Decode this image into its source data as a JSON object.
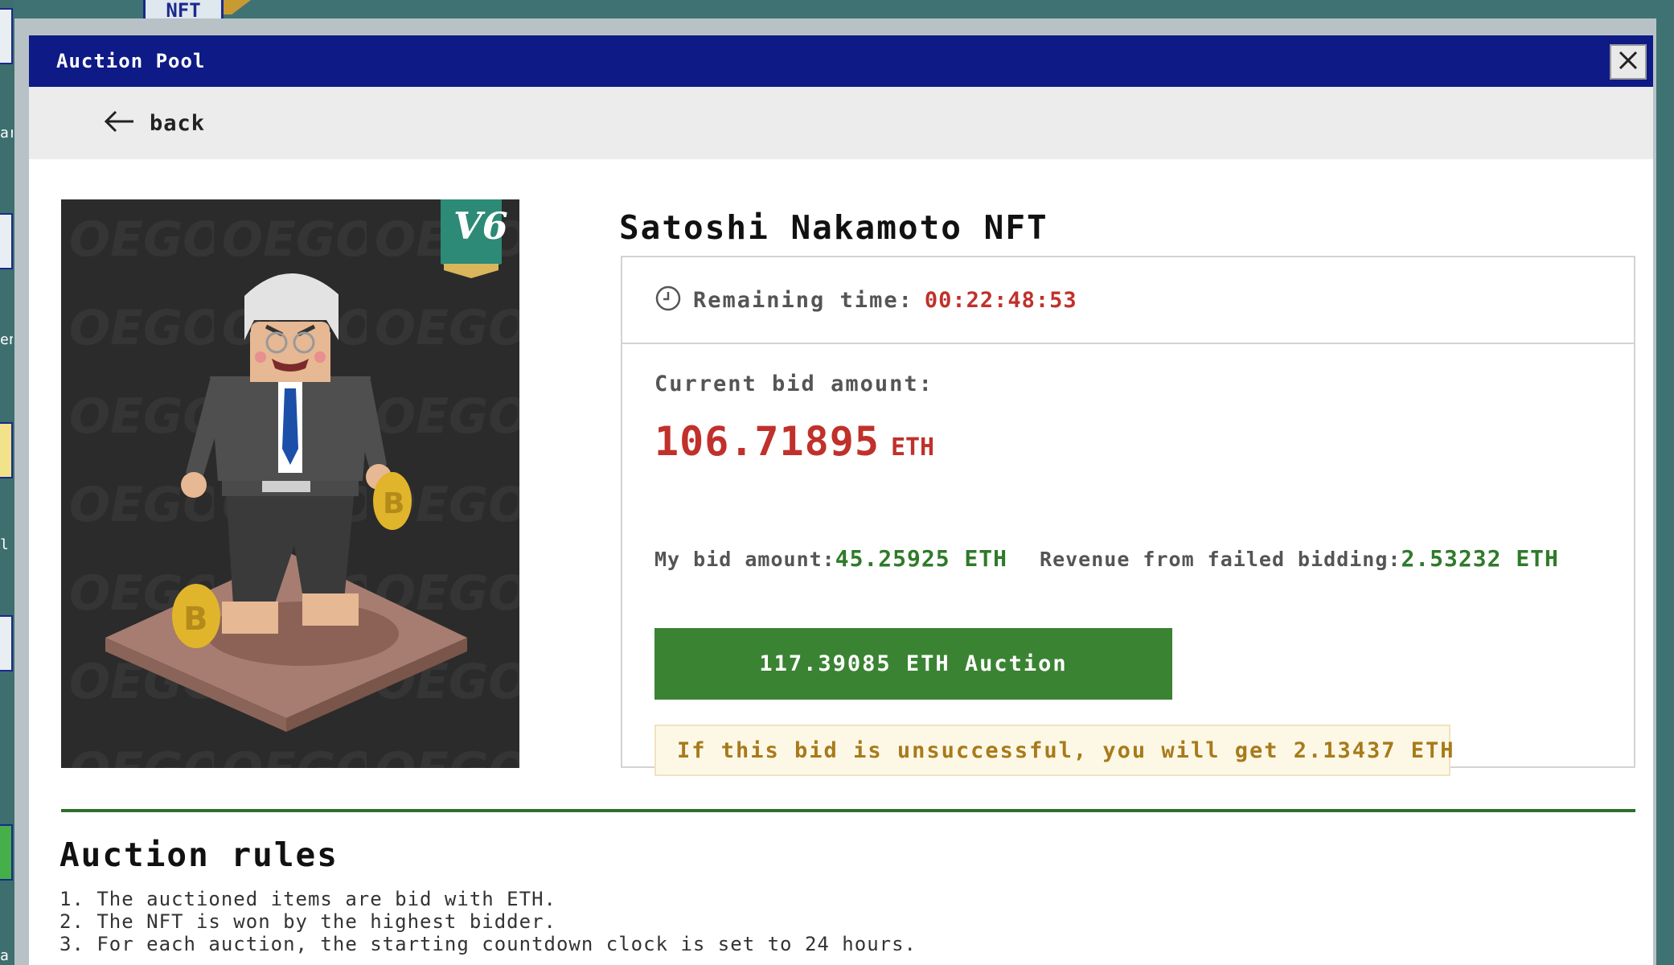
{
  "desktop": {
    "nft_icon_label": "NFT",
    "side_fragments": [
      "ar",
      "en",
      "l",
      "a"
    ]
  },
  "window": {
    "title": "Auction Pool",
    "close_icon": "close-icon"
  },
  "nav": {
    "back_label": "back",
    "back_icon": "arrow-left-icon"
  },
  "nft": {
    "title": "Satoshi Nakamoto NFT",
    "badge": "V6",
    "image_alt": "Lego-style minifigure with white hair holding bitcoin coins on a brown base"
  },
  "auction": {
    "remaining_label": "Remaining time:",
    "remaining_value": "00:22:48:53",
    "current_bid_label": "Current bid amount:",
    "current_bid_value": "106.71895",
    "current_bid_unit": "ETH",
    "my_bid_label": "My bid amount:",
    "my_bid_value": "45.25925 ETH",
    "failed_revenue_label": "Revenue from failed bidding:",
    "failed_revenue_value": "2.53232 ETH",
    "auction_button": "117.39085 ETH Auction",
    "unsuccessful_note": "If this bid is unsuccessful, you will get 2.13437 ETH"
  },
  "rules": {
    "title": "Auction rules",
    "items": [
      "1. The auctioned items are bid with ETH.",
      "2. The NFT is won by the highest bidder.",
      "3. For each auction, the starting countdown clock is set to 24 hours."
    ]
  },
  "colors": {
    "titlebar": "#0e1a85",
    "accent_red": "#c0312b",
    "accent_green": "#3a8332",
    "note_text": "#a87a1b"
  }
}
